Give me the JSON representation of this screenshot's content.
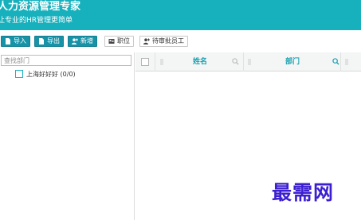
{
  "header": {
    "title": "人力资源管理专家",
    "subtitle": "让专业的HR管理更简单"
  },
  "toolbar": {
    "import_label": "导入",
    "export_label": "导出",
    "add_label": "新增",
    "position_label": "职位",
    "pending_label": "待审批员工"
  },
  "tree": {
    "search_placeholder": "查找部门",
    "nodes": [
      {
        "label": "上海好好好 (0/0)"
      }
    ]
  },
  "grid": {
    "columns": [
      {
        "title": "姓名",
        "searchable": true
      },
      {
        "title": "部门",
        "searchable": true
      }
    ]
  },
  "watermark": "最需网",
  "colors": {
    "header_bg": "#17b1bd",
    "primary_button": "#1793a8",
    "column_title": "#17a0b0",
    "watermark": "#3b1fd0"
  }
}
